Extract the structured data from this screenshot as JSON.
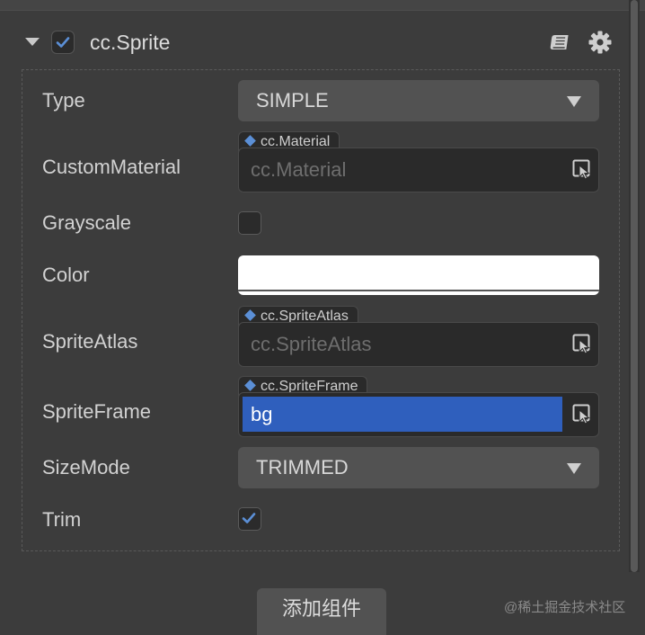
{
  "component": {
    "title": "cc.Sprite",
    "enabled": true
  },
  "properties": {
    "type": {
      "label": "Type",
      "value": "SIMPLE"
    },
    "custom_material": {
      "label": "CustomMaterial",
      "asset_type": "cc.Material",
      "placeholder": "cc.Material"
    },
    "grayscale": {
      "label": "Grayscale",
      "checked": false
    },
    "color": {
      "label": "Color",
      "value": "#FFFFFF"
    },
    "sprite_atlas": {
      "label": "SpriteAtlas",
      "asset_type": "cc.SpriteAtlas",
      "placeholder": "cc.SpriteAtlas"
    },
    "sprite_frame": {
      "label": "SpriteFrame",
      "asset_type": "cc.SpriteFrame",
      "value": "bg"
    },
    "size_mode": {
      "label": "SizeMode",
      "value": "TRIMMED"
    },
    "trim": {
      "label": "Trim",
      "checked": true
    }
  },
  "footer": {
    "add_component_label": "添加组件",
    "watermark": "@稀土掘金技术社区"
  },
  "icons": {
    "fold": "chevron-down-icon",
    "help": "book-icon",
    "settings": "gear-icon",
    "picker": "asset-picker-icon",
    "check": "checkmark-icon"
  },
  "colors": {
    "background": "#3c3c3c",
    "accent": "#2f5fbd",
    "check": "#5b8fd6"
  }
}
